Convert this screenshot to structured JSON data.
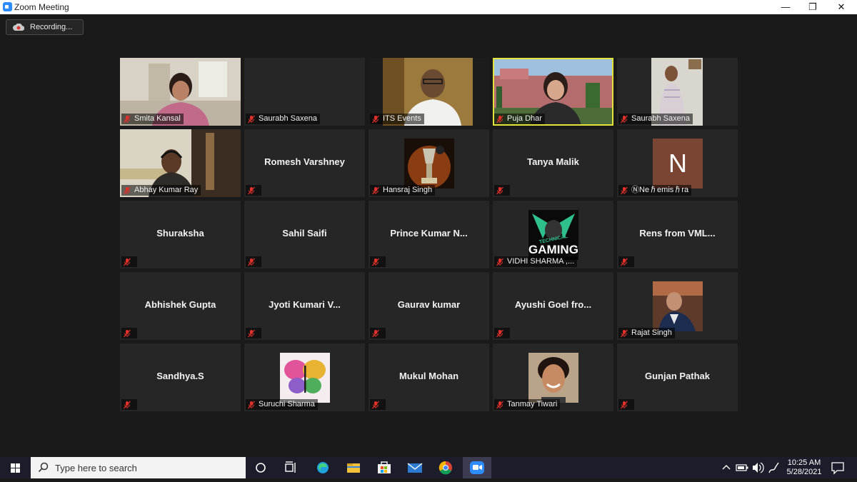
{
  "window": {
    "title": "Zoom Meeting"
  },
  "recording": {
    "label": "Recording..."
  },
  "tiles": [
    {
      "name": "Smita Kansal",
      "video": "woman-yellow"
    },
    {
      "name": "Saurabh Saxena",
      "video": "none"
    },
    {
      "name": "ITS Events",
      "video": "man-glasses"
    },
    {
      "name": "Puja Dhar",
      "video": "woman-building",
      "active": true
    },
    {
      "name": "Saurabh Saxena",
      "video": "man-standing"
    },
    {
      "name": "Abhay Kumar Ray",
      "video": "man-headset"
    },
    {
      "name": "Romesh Varshney",
      "label": "Romesh Varshney",
      "video": "none"
    },
    {
      "name": "Hansraj Singh",
      "video": "trophy-avatar"
    },
    {
      "name": "Tanya Malik",
      "label": "Tanya Malik",
      "video": "none"
    },
    {
      "name": "ⓃNeℏemisℏra",
      "video": "letter-avatar",
      "letter": "N"
    },
    {
      "name": "Shuraksha",
      "label": "Shuraksha",
      "video": "none"
    },
    {
      "name": "Sahil Saifi",
      "label": "Sahil Saifi",
      "video": "none"
    },
    {
      "name": "Prince Kumar N...",
      "label": "Prince Kumar N...",
      "video": "none"
    },
    {
      "name": "VIDHI SHARMA ,...",
      "video": "gaming-avatar",
      "avatar_text": [
        "TECHNICAL",
        "GAMING"
      ]
    },
    {
      "name": "Rens from VML...",
      "label": "Rens from VML...",
      "video": "none"
    },
    {
      "name": "Abhishek Gupta",
      "label": "Abhishek Gupta",
      "video": "none"
    },
    {
      "name": "Jyoti Kumari V...",
      "label": "Jyoti Kumari V...",
      "video": "none"
    },
    {
      "name": "Gaurav kumar",
      "label": "Gaurav kumar",
      "video": "none"
    },
    {
      "name": "Ayushi Goel fro...",
      "label": "Ayushi Goel fro...",
      "video": "none"
    },
    {
      "name": "Rajat Singh",
      "video": "suit-avatar"
    },
    {
      "name": "Sandhya.S",
      "label": "Sandhya.S",
      "video": "none"
    },
    {
      "name": "Suruchi Sharma",
      "video": "butterfly-avatar"
    },
    {
      "name": "Mukul Mohan",
      "label": "Mukul Mohan",
      "video": "none"
    },
    {
      "name": "Tanmay Tiwari",
      "video": "boy-avatar"
    },
    {
      "name": "Gunjan Pathak",
      "label": "Gunjan Pathak",
      "video": "none"
    }
  ],
  "taskbar": {
    "search_placeholder": "Type here to search",
    "apps": [
      "cortana-icon",
      "task-view-icon",
      "edge-icon",
      "file-explorer-icon",
      "store-icon",
      "mail-icon",
      "chrome-icon",
      "zoom-icon"
    ],
    "time": "10:25 AM",
    "date": "5/28/2021"
  },
  "colors": {
    "accent_active": "#e3e33a",
    "tile_bg": "#262626",
    "muted_red": "#e0312b",
    "zoom_blue": "#2d8cff"
  }
}
